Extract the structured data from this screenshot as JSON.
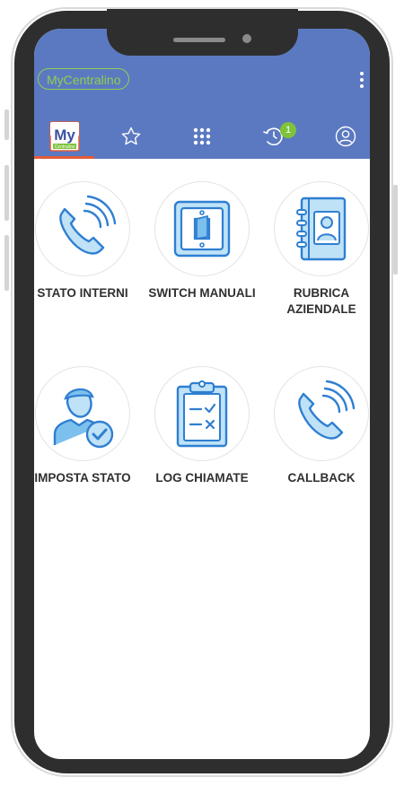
{
  "app": {
    "brand": "MyCentralino",
    "logo_text": "My",
    "logo_subtext": "Centralino"
  },
  "tabs": [
    {
      "name": "home",
      "icon": "mycentralino-logo-icon",
      "active": true
    },
    {
      "name": "favorites",
      "icon": "star-icon"
    },
    {
      "name": "keypad",
      "icon": "keypad-icon"
    },
    {
      "name": "history",
      "icon": "history-icon",
      "badge": "1"
    },
    {
      "name": "profile",
      "icon": "user-circle-icon"
    }
  ],
  "features": [
    {
      "id": "stato-interni",
      "label": "STATO INTERNI",
      "icon": "phone-ringing-icon"
    },
    {
      "id": "switch-manuali",
      "label": "SWITCH MANUALI",
      "icon": "light-switch-icon"
    },
    {
      "id": "rubrica-aziendale",
      "label": "RUBRICA AZIENDALE",
      "icon": "address-book-icon"
    },
    {
      "id": "imposta-stato",
      "label": "IMPOSTA STATO",
      "icon": "user-check-icon"
    },
    {
      "id": "log-chiamate",
      "label": "LOG CHIAMATE",
      "icon": "clipboard-log-icon"
    },
    {
      "id": "callback",
      "label": "CALLBACK",
      "icon": "phone-callback-icon"
    }
  ],
  "colors": {
    "header": "#5b79c1",
    "brand_green": "#8cd150",
    "icon_blue": "#3a89d6",
    "icon_fill": "#bfe2f7",
    "active_tab_underline": "#e35b3a",
    "badge": "#7ec33b"
  }
}
